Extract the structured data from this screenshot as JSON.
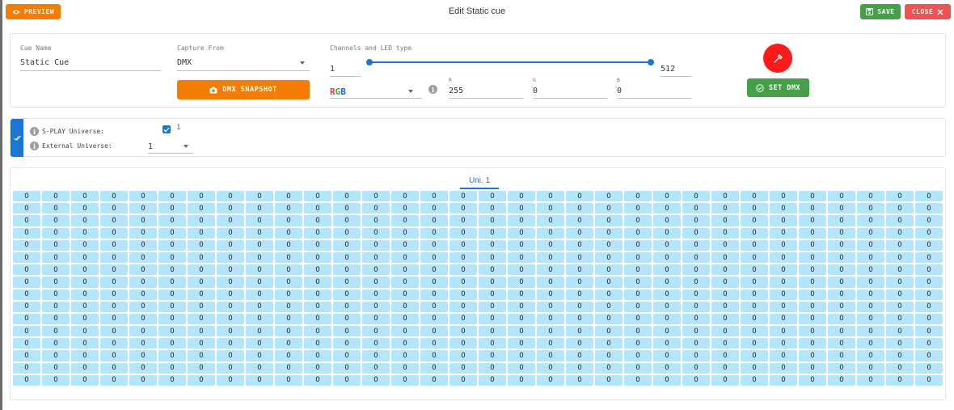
{
  "header": {
    "title": "Edit Static cue",
    "preview_label": "PREVIEW",
    "save_label": "SAVE",
    "close_label": "CLOSE"
  },
  "cue": {
    "name_label": "Cue Name",
    "name_value": "Static Cue",
    "capture_label": "Capture From",
    "capture_value": "DMX",
    "snapshot_label": "DMX SNAPSHOT",
    "channels_label": "Channels and LED type",
    "range_start": "1",
    "range_end": "512",
    "led_type": "RGB",
    "r_label": "R",
    "r_value": "255",
    "g_label": "G",
    "g_value": "0",
    "b_label": "B",
    "b_value": "0",
    "set_dmx_label": "SET DMX",
    "picked_color": "#ff1a1a"
  },
  "universe": {
    "splay_label": "S-PLAY Universe:",
    "splay_value": "1",
    "splay_checked": true,
    "external_label": "External Universe:",
    "external_value": "1"
  },
  "grid": {
    "tab_label": "Uni. 1",
    "columns": 32,
    "rows": 16,
    "default_value": "0"
  },
  "colors": {
    "accent": "#1976d2",
    "orange": "#f57c00",
    "green": "#43a047",
    "red": "#ef5350",
    "cell": "#b3e5fc"
  }
}
